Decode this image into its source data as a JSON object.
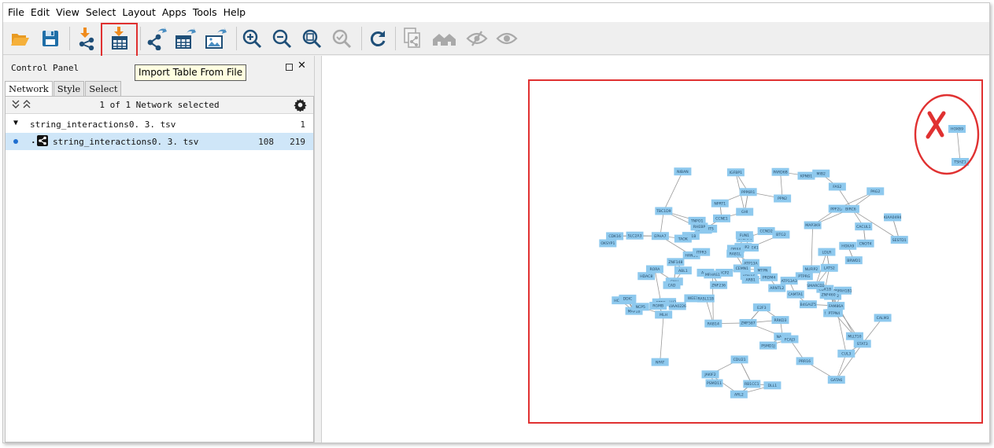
{
  "menu": {
    "items": [
      "File",
      "Edit",
      "View",
      "Select",
      "Layout",
      "Apps",
      "Tools",
      "Help"
    ]
  },
  "toolbar": {
    "buttons": [
      {
        "name": "open-session",
        "icon": "folder-open-icon"
      },
      {
        "name": "save-session",
        "icon": "save-icon"
      },
      {
        "name": "import-network",
        "icon": "import-network-icon"
      },
      {
        "name": "import-table",
        "icon": "import-table-icon"
      },
      {
        "name": "export-network",
        "icon": "export-network-icon"
      },
      {
        "name": "export-table",
        "icon": "export-table-icon"
      },
      {
        "name": "export-image",
        "icon": "export-image-icon"
      },
      {
        "name": "zoom-in",
        "icon": "zoom-in-icon"
      },
      {
        "name": "zoom-out",
        "icon": "zoom-out-icon"
      },
      {
        "name": "zoom-fit",
        "icon": "zoom-fit-icon"
      },
      {
        "name": "zoom-selected",
        "icon": "zoom-selected-icon"
      },
      {
        "name": "apply-style",
        "icon": "refresh-icon"
      },
      {
        "name": "new-network-from-selection",
        "icon": "copy-network-icon"
      },
      {
        "name": "show-home",
        "icon": "home-icon"
      },
      {
        "name": "hide-selected",
        "icon": "eye-slash-icon"
      },
      {
        "name": "show-all",
        "icon": "eye-icon"
      }
    ],
    "tooltip": "Import Table From File",
    "highlight_color": "#e03131"
  },
  "control_panel": {
    "title": "Control Panel",
    "tabs": [
      "Network",
      "Style",
      "Select"
    ],
    "active_tab": "Network",
    "summary": "1 of 1 Network selected",
    "collection": {
      "name": "string_interactions0. 3. tsv",
      "count": "1"
    },
    "network": {
      "name": "string_interactions0. 3. tsv",
      "nodes": "108",
      "edges": "219"
    },
    "selection_color": "#cfe6f8"
  },
  "canvas": {
    "node_color": "#8ec9ee",
    "edge_color": "#9a9a9a",
    "annotation_color": "#e03131",
    "nodes": [
      {
        "id": "HOXB9",
        "label": "HOXB9"
      },
      {
        "id": "TSHZ1",
        "label": "TSHZ1"
      },
      {
        "id": "RORA",
        "label": "RORA"
      },
      {
        "id": "DYNC1LI2",
        "label": "DYNC1LI2"
      },
      {
        "id": "KIF1B",
        "label": "KIF1B"
      },
      {
        "id": "BHLHE41",
        "label": "BHLHE41"
      },
      {
        "id": "STEAP4",
        "label": "STEAP4"
      },
      {
        "id": "ARNTL2",
        "label": "ARNTL2"
      },
      {
        "id": "SEMA6A",
        "label": "SEMA6A"
      },
      {
        "id": "KIAA0226",
        "label": "KIAA0226"
      },
      {
        "id": "GATA6",
        "label": "GATA6"
      },
      {
        "id": "HAND1",
        "label": "HAND1"
      },
      {
        "id": "RAB14",
        "label": "RAB14"
      },
      {
        "id": "DLL1",
        "label": "DLL1"
      },
      {
        "id": "RNF217",
        "label": "RNF217"
      },
      {
        "id": "CAMTA1",
        "label": "CAMTA1"
      },
      {
        "id": "PAFAH1B1",
        "label": "PAFAH1B1"
      },
      {
        "id": "LDLR",
        "label": "LDLR"
      },
      {
        "id": "MAP1B",
        "label": "MAP1B"
      },
      {
        "id": "E2F3",
        "label": "E2F3"
      },
      {
        "id": "RB1CC1",
        "label": "RB1CC1"
      },
      {
        "id": "KIAA0494",
        "label": "KIAA0494"
      },
      {
        "id": "ATP13A",
        "label": "ATP13A"
      },
      {
        "id": "NABP1",
        "label": "NABP1"
      },
      {
        "id": "ARL2",
        "label": "ARL2"
      },
      {
        "id": "TAOK",
        "label": "TAOK"
      },
      {
        "id": "CDC25",
        "label": "CDC25"
      },
      {
        "id": "STAT3",
        "label": "STAT3"
      },
      {
        "id": "PTPRG",
        "label": "PTPRG"
      },
      {
        "id": "NIBAN",
        "label": "NIBAN"
      },
      {
        "id": "MTPN",
        "label": "MTPN"
      },
      {
        "id": "SLC2A3",
        "label": "SLC2A3"
      },
      {
        "id": "CEMN1",
        "label": "CEMN1"
      },
      {
        "id": "CDK1B",
        "label": "CDK1B"
      },
      {
        "id": "CCND2",
        "label": "CCND2"
      },
      {
        "id": "LOMP2",
        "label": "LOMP2"
      },
      {
        "id": "CMH",
        "label": "CMH"
      },
      {
        "id": "NCP5",
        "label": "NCP5"
      },
      {
        "id": "IGFBP1",
        "label": "IGFBP1"
      },
      {
        "id": "CALM3",
        "label": "CALM3"
      },
      {
        "id": "RRKD3",
        "label": "RRKD3"
      },
      {
        "id": "WEE1",
        "label": "WEE1"
      },
      {
        "id": "ZNF148",
        "label": "ZNF148"
      },
      {
        "id": "NPRT1",
        "label": "NPRT1"
      },
      {
        "id": "HOXA5",
        "label": "HOXA5"
      },
      {
        "id": "HDAC8",
        "label": "HDAC8"
      },
      {
        "id": "CDK16",
        "label": "CDK16"
      },
      {
        "id": "KPNA6",
        "label": "KPNA6"
      },
      {
        "id": "CCNE1",
        "label": "CCNE1"
      },
      {
        "id": "ABL1",
        "label": "ABL1"
      },
      {
        "id": "ROCK2",
        "label": "ROCK2"
      },
      {
        "id": "FUN1",
        "label": "FUN1"
      },
      {
        "id": "FCAJ3",
        "label": "FCAJ3"
      },
      {
        "id": "HOXA9",
        "label": "HOXA9"
      },
      {
        "id": "PRR16",
        "label": "PRR16"
      },
      {
        "id": "PSMD11",
        "label": "PSMD11"
      },
      {
        "id": "BTG2",
        "label": "BTG2"
      },
      {
        "id": "PPF2LA",
        "label": "PPF2LA"
      },
      {
        "id": "ACLY",
        "label": "ACLY"
      },
      {
        "id": "ARB1",
        "label": "ARB1"
      },
      {
        "id": "CAD",
        "label": "CAD"
      },
      {
        "id": "ZNF236",
        "label": "ZNF236"
      },
      {
        "id": "MLLT10",
        "label": "MLLT10"
      },
      {
        "id": "ITPR3",
        "label": "ITPR3"
      },
      {
        "id": "PPP6R1",
        "label": "PPP6R1"
      },
      {
        "id": "PAG2",
        "label": "PAG2"
      },
      {
        "id": "PPN2",
        "label": "PPN2"
      },
      {
        "id": "CUL3",
        "label": "CUL3"
      },
      {
        "id": "ZMF587",
        "label": "ZMF587"
      },
      {
        "id": "CACUL1",
        "label": "CACUL1"
      },
      {
        "id": "CDU21",
        "label": "CDU21"
      },
      {
        "id": "CNOT4",
        "label": "CNOT4"
      },
      {
        "id": "EPHA7",
        "label": "EPHA7"
      },
      {
        "id": "MIB2",
        "label": "MIB2"
      },
      {
        "id": "TNPO1",
        "label": "TNPO1"
      },
      {
        "id": "NFAT",
        "label": "NFAT"
      },
      {
        "id": "DDIC",
        "label": "DDIC"
      },
      {
        "id": "MAP3K9",
        "label": "MAP3K9"
      },
      {
        "id": "ZNF460",
        "label": "ZNF460"
      },
      {
        "id": "KPNB1",
        "label": "KPNB1"
      },
      {
        "id": "DCP2",
        "label": "DCP2"
      },
      {
        "id": "PSMD1J",
        "label": "PSMD1J"
      },
      {
        "id": "TBC1D9",
        "label": "TBC1D9"
      },
      {
        "id": "BRWD1",
        "label": "BRWD1"
      },
      {
        "id": "OBX4",
        "label": "OBX4"
      },
      {
        "id": "MLH",
        "label": "MLH"
      },
      {
        "id": "PRDM4",
        "label": "PRDM4"
      },
      {
        "id": "FAS2",
        "label": "FAS2"
      },
      {
        "id": "LATS2",
        "label": "LATS2"
      },
      {
        "id": "SUITS",
        "label": "SUITS"
      },
      {
        "id": "RAB1L",
        "label": "RAB1L"
      },
      {
        "id": "NUFIP2",
        "label": "NUFIP2"
      },
      {
        "id": "SMARCD2",
        "label": "SMARCD2"
      },
      {
        "id": "OKSYP1",
        "label": "OKSYP1"
      },
      {
        "id": "ATP13A3",
        "label": "ATP13A3"
      },
      {
        "id": "B4GALT5",
        "label": "B4GALT5"
      },
      {
        "id": "JAKIF2",
        "label": "JAKIF2"
      },
      {
        "id": "BIRC6",
        "label": "BIRC6"
      },
      {
        "id": "MFHAS1",
        "label": "MFHAS1"
      },
      {
        "id": "RHEBP",
        "label": "RHEBP"
      },
      {
        "id": "PTPN4",
        "label": "PTPN4"
      },
      {
        "id": "PARD6B",
        "label": "PARD6B"
      },
      {
        "id": "FAM86A",
        "label": "FAM86A"
      },
      {
        "id": "RASL11B",
        "label": "RASL11B"
      },
      {
        "id": "GHI",
        "label": "GHI"
      },
      {
        "id": "FRTG",
        "label": "FRTG"
      },
      {
        "id": "RGMB",
        "label": "RGMB"
      },
      {
        "id": "SESTD1",
        "label": "SESTD1"
      }
    ]
  }
}
